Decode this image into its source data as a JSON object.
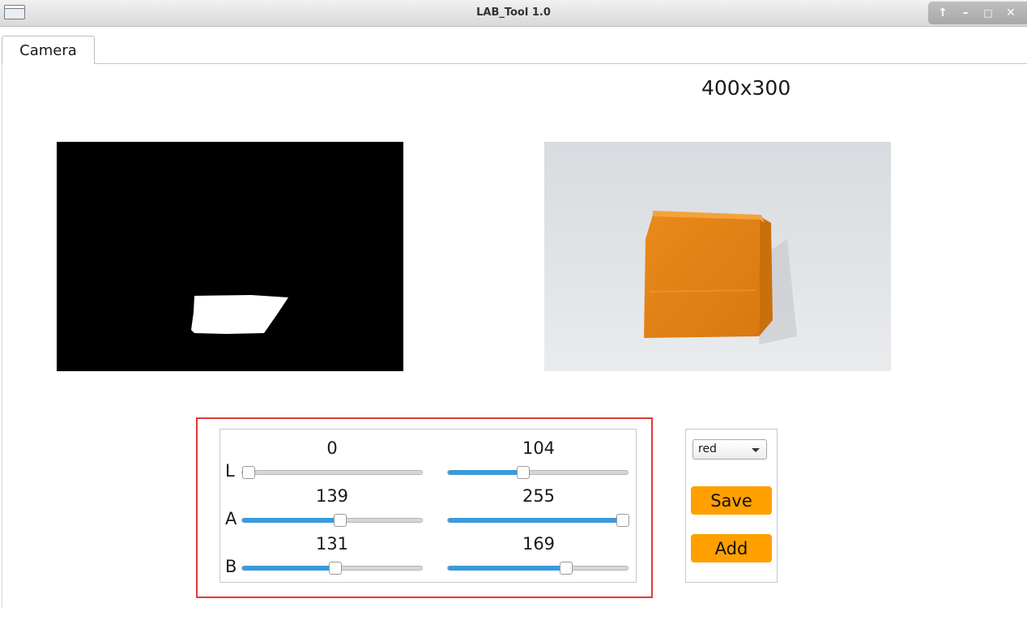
{
  "window": {
    "title": "LAB_Tool 1.0",
    "controls": [
      "↑",
      "–",
      "□",
      "✕"
    ]
  },
  "tabs": [
    {
      "label": "Camera",
      "active": true
    }
  ],
  "resolution_label": "400x300",
  "thresholds": {
    "rows": [
      {
        "channel": "L",
        "min": 0,
        "max": 104
      },
      {
        "channel": "A",
        "min": 139,
        "max": 255
      },
      {
        "channel": "B",
        "min": 131,
        "max": 169
      }
    ],
    "range_max": 255
  },
  "controls": {
    "color_select": {
      "value": "red"
    },
    "save_label": "Save",
    "add_label": "Add"
  },
  "colors": {
    "accent_button": "#ffa000",
    "slider_fill": "#3b9ad9",
    "highlight_border": "#e53935"
  }
}
